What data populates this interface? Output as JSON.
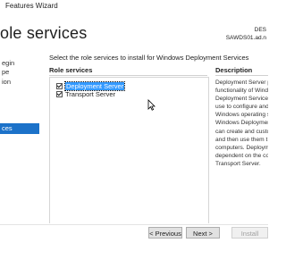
{
  "window": {
    "title": "Features Wizard"
  },
  "page": {
    "title": "ole services",
    "server_line1": "DES",
    "server_line2": "SAWDS01.ad.n"
  },
  "nav": [
    {
      "label": "egin",
      "active": false
    },
    {
      "label": "pe",
      "active": false
    },
    {
      "label": "ion",
      "active": false
    },
    {
      "label": "ces",
      "active": true
    }
  ],
  "main": {
    "instruction": "Select the role services to install for Windows Deployment Services",
    "role_services_header": "Role services",
    "description_header": "Description",
    "services": [
      {
        "label": "Deployment Server",
        "checked": true,
        "selected": true
      },
      {
        "label": "Transport Server",
        "checked": true,
        "selected": false
      }
    ],
    "description_lines": [
      "Deployment Server p",
      "functionality of Wind",
      "Deployment Services",
      "use to configure and",
      "Windows operating s",
      "Windows Deploymen",
      "can create and custo",
      "and then use them t",
      "computers. Deploym",
      "dependent on the co",
      "Transport Server."
    ]
  },
  "footer": {
    "previous": "< Previous",
    "next": "Next >",
    "install": "Install"
  }
}
